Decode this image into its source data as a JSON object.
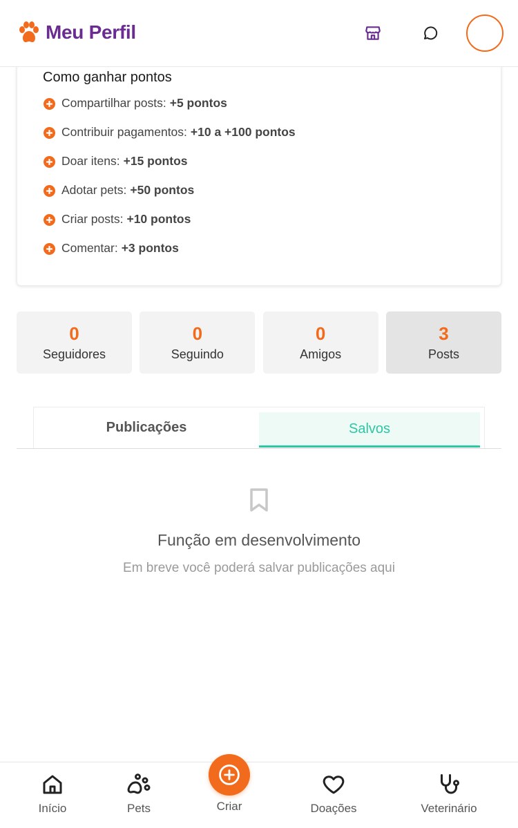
{
  "header": {
    "title": "Meu Perfil",
    "icons": {
      "brand": "paw-icon",
      "store": "store-icon",
      "chat": "chat-bubble-icon"
    }
  },
  "points": {
    "title": "Como ganhar pontos",
    "items": [
      {
        "label": "Compartilhar posts:",
        "value": "+5 pontos"
      },
      {
        "label": "Contribuir pagamentos:",
        "value": "+10 a +100 pontos"
      },
      {
        "label": "Doar itens:",
        "value": "+15 pontos"
      },
      {
        "label": "Adotar pets:",
        "value": "+50 pontos"
      },
      {
        "label": "Criar posts:",
        "value": "+10 pontos"
      },
      {
        "label": "Comentar:",
        "value": "+3 pontos"
      }
    ]
  },
  "stats": [
    {
      "value": "0",
      "label": "Seguidores"
    },
    {
      "value": "0",
      "label": "Seguindo"
    },
    {
      "value": "0",
      "label": "Amigos"
    },
    {
      "value": "3",
      "label": "Posts"
    }
  ],
  "tabs": {
    "publications": "Publicações",
    "saved": "Salvos",
    "active": "saved"
  },
  "empty": {
    "title": "Função em desenvolvimento",
    "subtitle": "Em breve você poderá salvar publicações aqui"
  },
  "nav": {
    "inicio": "Início",
    "pets": "Pets",
    "criar": "Criar",
    "doacoes": "Doações",
    "veterinario": "Veterinário"
  },
  "colors": {
    "accent": "#f26a1b",
    "brand": "#6a2c91",
    "tab_active": "#2ec7a3"
  }
}
